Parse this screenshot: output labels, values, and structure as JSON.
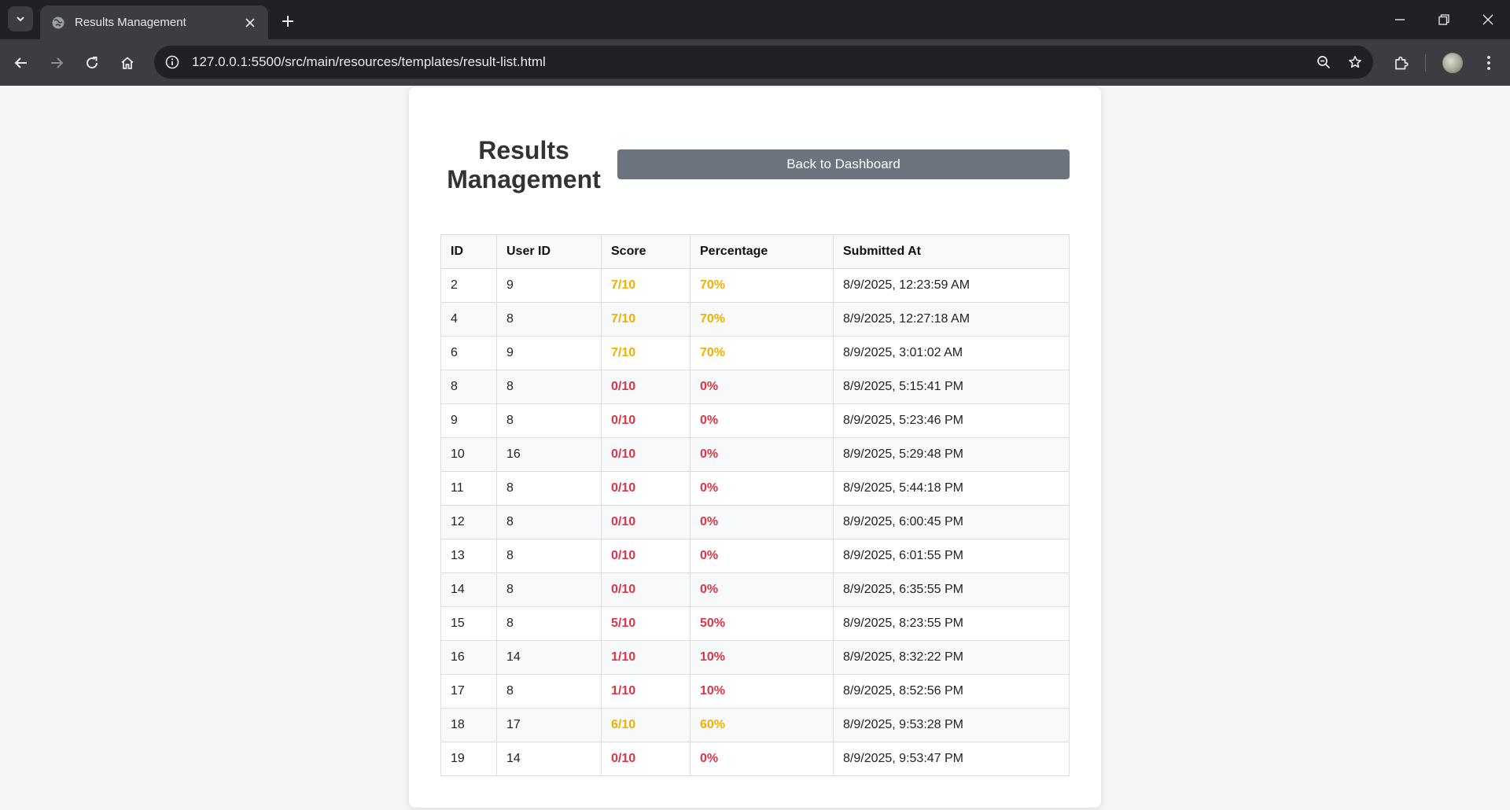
{
  "browser": {
    "tab_title": "Results Management",
    "url": "127.0.0.1:5500/src/main/resources/templates/result-list.html"
  },
  "page": {
    "title": "Results Management",
    "back_button": "Back to Dashboard"
  },
  "table": {
    "headers": [
      "ID",
      "User ID",
      "Score",
      "Percentage",
      "Submitted At"
    ],
    "rows": [
      {
        "id": "2",
        "user_id": "9",
        "score": "7/10",
        "percentage": "70%",
        "submitted_at": "8/9/2025, 12:23:59 AM",
        "status": "warn"
      },
      {
        "id": "4",
        "user_id": "8",
        "score": "7/10",
        "percentage": "70%",
        "submitted_at": "8/9/2025, 12:27:18 AM",
        "status": "warn"
      },
      {
        "id": "6",
        "user_id": "9",
        "score": "7/10",
        "percentage": "70%",
        "submitted_at": "8/9/2025, 3:01:02 AM",
        "status": "warn"
      },
      {
        "id": "8",
        "user_id": "8",
        "score": "0/10",
        "percentage": "0%",
        "submitted_at": "8/9/2025, 5:15:41 PM",
        "status": "bad"
      },
      {
        "id": "9",
        "user_id": "8",
        "score": "0/10",
        "percentage": "0%",
        "submitted_at": "8/9/2025, 5:23:46 PM",
        "status": "bad"
      },
      {
        "id": "10",
        "user_id": "16",
        "score": "0/10",
        "percentage": "0%",
        "submitted_at": "8/9/2025, 5:29:48 PM",
        "status": "bad"
      },
      {
        "id": "11",
        "user_id": "8",
        "score": "0/10",
        "percentage": "0%",
        "submitted_at": "8/9/2025, 5:44:18 PM",
        "status": "bad"
      },
      {
        "id": "12",
        "user_id": "8",
        "score": "0/10",
        "percentage": "0%",
        "submitted_at": "8/9/2025, 6:00:45 PM",
        "status": "bad"
      },
      {
        "id": "13",
        "user_id": "8",
        "score": "0/10",
        "percentage": "0%",
        "submitted_at": "8/9/2025, 6:01:55 PM",
        "status": "bad"
      },
      {
        "id": "14",
        "user_id": "8",
        "score": "0/10",
        "percentage": "0%",
        "submitted_at": "8/9/2025, 6:35:55 PM",
        "status": "bad"
      },
      {
        "id": "15",
        "user_id": "8",
        "score": "5/10",
        "percentage": "50%",
        "submitted_at": "8/9/2025, 8:23:55 PM",
        "status": "bad"
      },
      {
        "id": "16",
        "user_id": "14",
        "score": "1/10",
        "percentage": "10%",
        "submitted_at": "8/9/2025, 8:32:22 PM",
        "status": "bad"
      },
      {
        "id": "17",
        "user_id": "8",
        "score": "1/10",
        "percentage": "10%",
        "submitted_at": "8/9/2025, 8:52:56 PM",
        "status": "bad"
      },
      {
        "id": "18",
        "user_id": "17",
        "score": "6/10",
        "percentage": "60%",
        "submitted_at": "8/9/2025, 9:53:28 PM",
        "status": "warn"
      },
      {
        "id": "19",
        "user_id": "14",
        "score": "0/10",
        "percentage": "0%",
        "submitted_at": "8/9/2025, 9:53:47 PM",
        "status": "bad"
      }
    ]
  },
  "colors": {
    "warn": "#f0b000",
    "bad": "#dc3545",
    "button_bg": "#6c757d"
  },
  "icons": {
    "tab_menu": "chevron-down-icon",
    "favicon": "globe-icon",
    "tab_close": "close-icon",
    "new_tab": "plus-icon",
    "back": "arrow-left-icon",
    "forward": "arrow-right-icon",
    "reload": "reload-icon",
    "home": "home-icon",
    "site_info": "info-icon",
    "zoom": "zoom-out-icon",
    "bookmark": "star-icon",
    "extensions": "puzzle-icon",
    "profile": "avatar",
    "menu": "kebab-menu-icon"
  }
}
